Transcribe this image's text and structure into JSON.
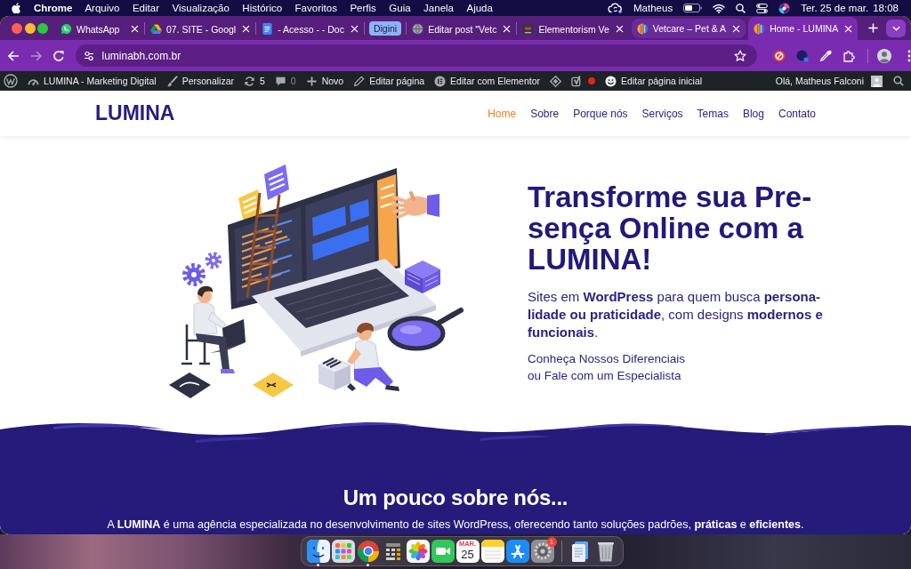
{
  "menu_bar": {
    "app_name": "Chrome",
    "menus": [
      "Arquivo",
      "Editar",
      "Visualização",
      "Histórico",
      "Favoritos",
      "Perfis",
      "Guia",
      "Janela",
      "Ajuda"
    ],
    "user": "Matheus",
    "date": "Ter. 25 de mar.",
    "time": "18:08"
  },
  "browser": {
    "tabs": [
      {
        "kind": "tab",
        "title": "WhatsApp",
        "selected": false,
        "highlighted": false
      },
      {
        "kind": "tab",
        "title": "07. SITE - Googl",
        "selected": false,
        "highlighted": false
      },
      {
        "kind": "tab",
        "title": "- Acesso - - Doc",
        "selected": false,
        "highlighted": false
      },
      {
        "kind": "group",
        "title": "Digini",
        "selected": false,
        "highlighted": false
      },
      {
        "kind": "tab",
        "title": "Editar post \"Vetc",
        "selected": false,
        "highlighted": false
      },
      {
        "kind": "tab",
        "title": "Elementorism Ve",
        "selected": false,
        "highlighted": false
      },
      {
        "kind": "tab",
        "title": "Vetcare – Pet & A",
        "selected": false,
        "highlighted": true
      },
      {
        "kind": "tab",
        "title": "Home - LUMINA",
        "selected": true,
        "highlighted": false
      }
    ],
    "nav_buttons": [
      {
        "disabled": false
      },
      {
        "disabled": true
      },
      {
        "disabled": false
      }
    ],
    "address": "luminabh.com.br",
    "bookmarked": false
  },
  "admin_bar": {
    "items": [
      {
        "muted": false
      },
      {
        "label": "LUMINA - Marketing Digital",
        "muted": false
      },
      {
        "label": "Personalizar",
        "muted": false
      },
      {
        "label": "5",
        "muted": false
      },
      {
        "label": "0",
        "muted": true
      },
      {
        "label": "Novo",
        "muted": false
      },
      {
        "label": "Editar página",
        "muted": false
      },
      {
        "label": "Editar com Elementor",
        "muted": false
      },
      {
        "muted": false
      },
      {
        "muted": false,
        "color": "#e5221c"
      },
      {
        "label": "Editar página inicial",
        "muted": false
      }
    ],
    "greeting": "Olá, Matheus Falconi"
  },
  "site_header": {
    "logo": "LUMINA",
    "nav": [
      {
        "label": "Home",
        "selected": true
      },
      {
        "label": "Sobre",
        "selected": false
      },
      {
        "label": "Porque nós",
        "selected": false
      },
      {
        "label": "Serviços",
        "selected": false
      },
      {
        "label": "Temas",
        "selected": false
      },
      {
        "label": "Blog",
        "selected": false
      },
      {
        "label": "Contato",
        "selected": false
      }
    ]
  },
  "hero": {
    "headline": "Transforme sua Pre-sença Online com a LUMINA!",
    "text": "Sites em **WordPress** para quem busca **persona-lidade ou praticidade**, com designs **modernos e funcionais**.",
    "links": [
      "Conheça Nossos Diferenciais",
      "ou Fale com um Especialista"
    ]
  },
  "about": {
    "title": "Um pouco sobre nós...",
    "text": "A **LUMINA** é uma agência especializada no desenvolvimento de sites WordPress, oferecendo tanto soluções padrões, **práticas** e **eficientes**."
  },
  "dock": {
    "apps": [
      {
        "running": true
      },
      {
        "running": false
      },
      {
        "running": true
      },
      {
        "running": false
      },
      {
        "running": false
      },
      {
        "running": false
      },
      {
        "running": false,
        "month": "MAR.",
        "day": "25"
      },
      {
        "running": false
      },
      {
        "running": false
      },
      {
        "running": false,
        "badge": "1"
      }
    ],
    "stack": [
      {
        "running": false
      },
      {
        "running": false
      }
    ]
  }
}
